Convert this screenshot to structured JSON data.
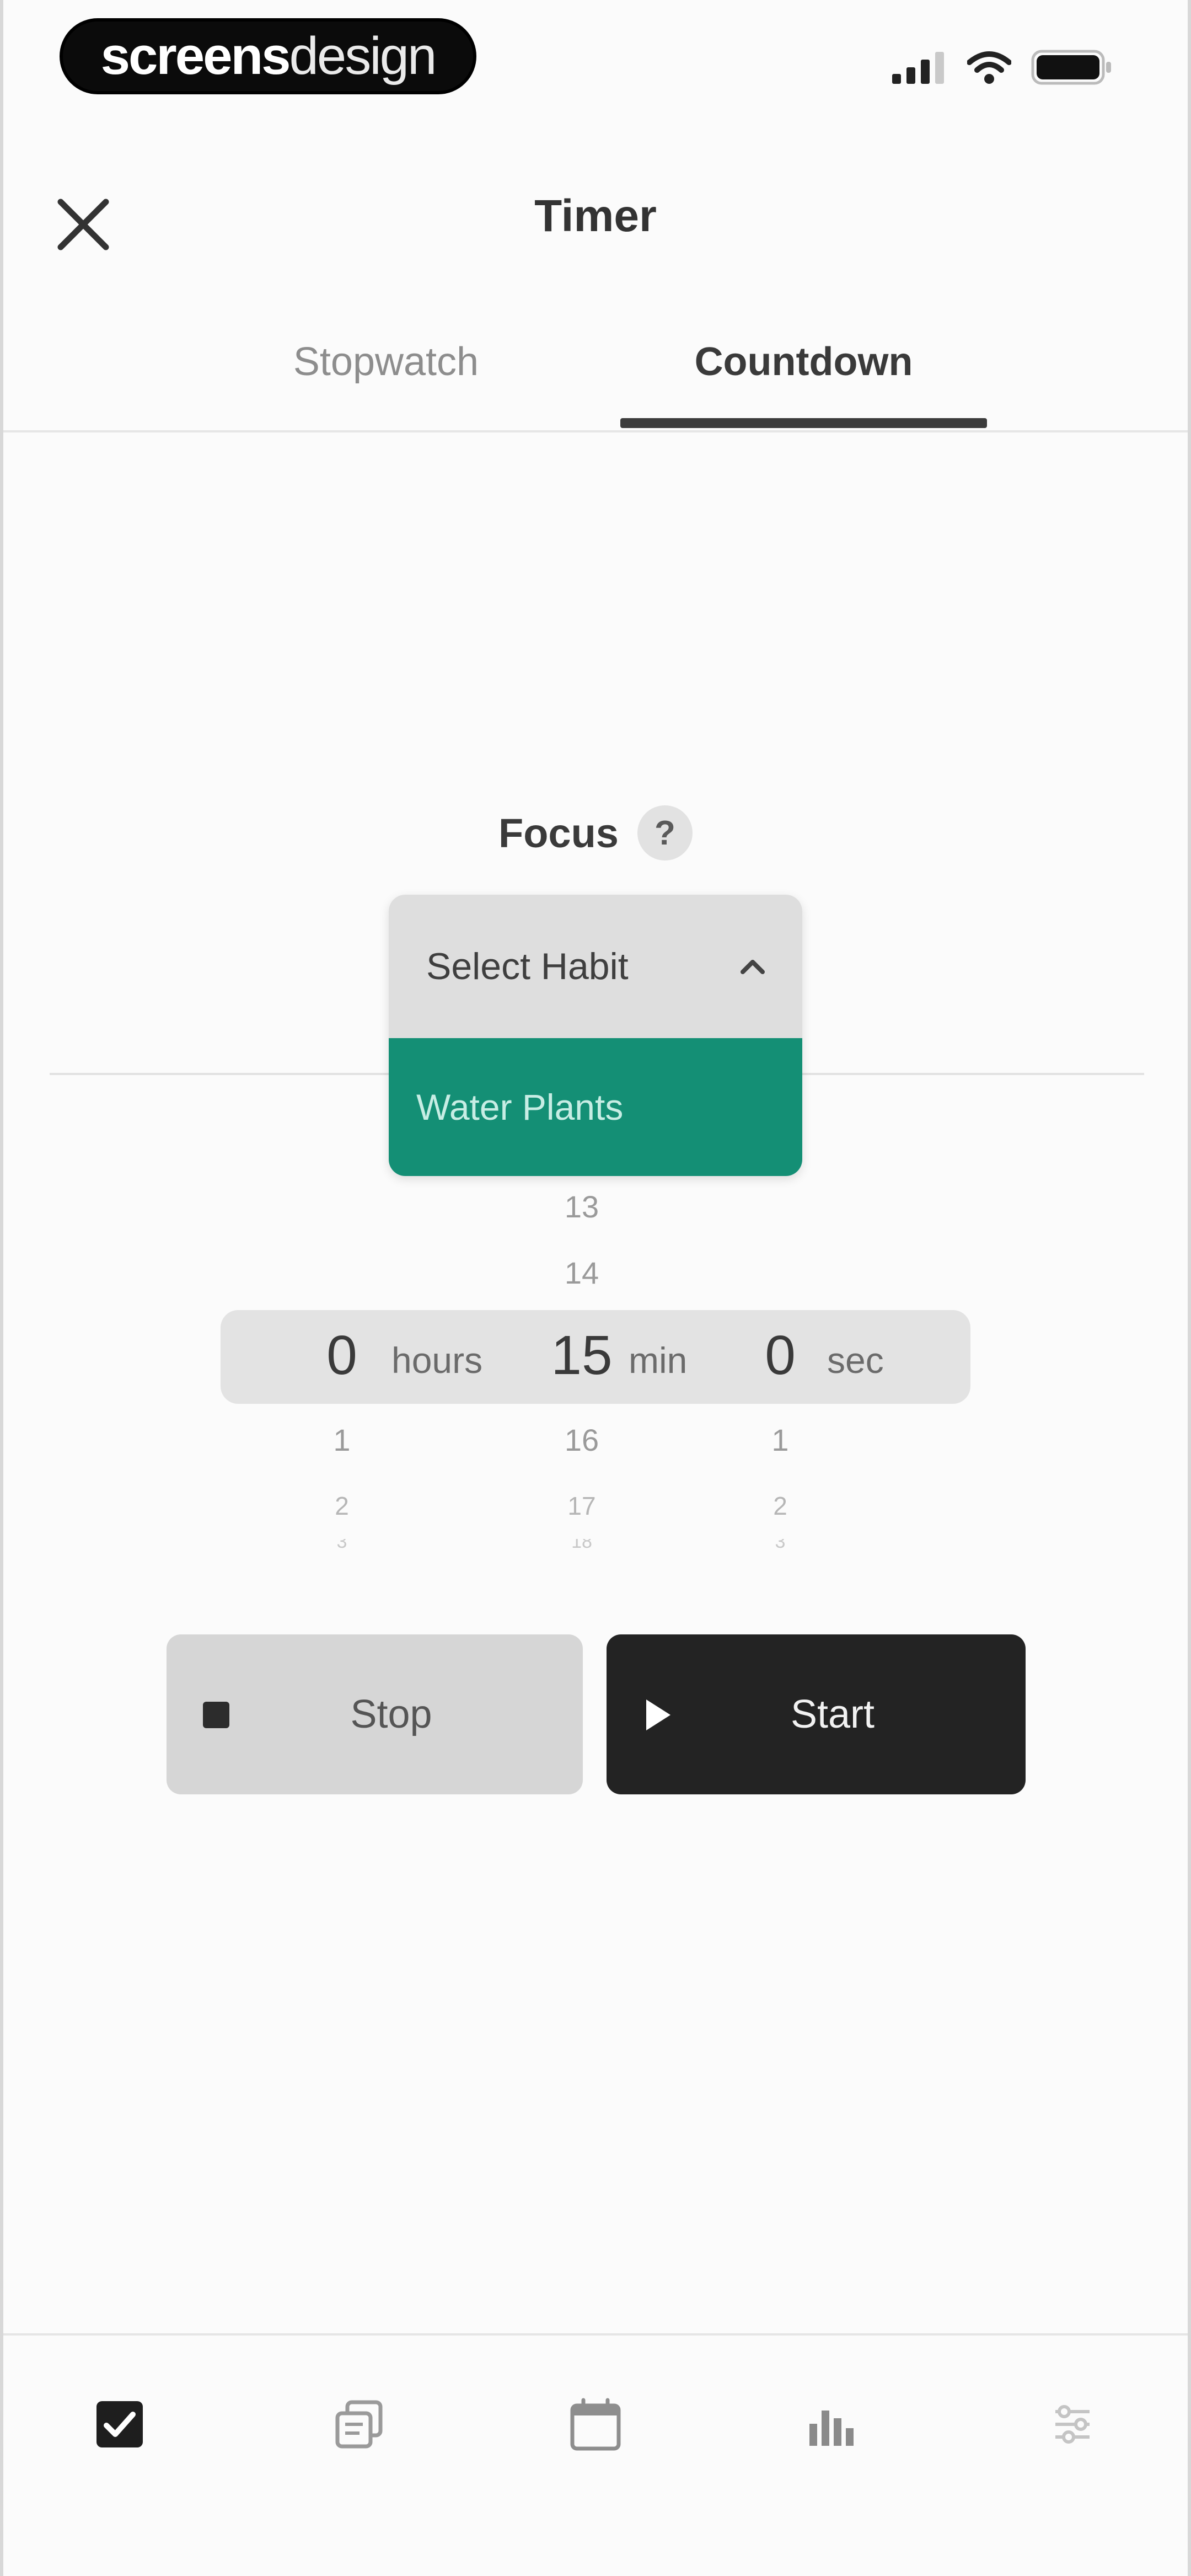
{
  "status_bar": {
    "brand_bold": "screens",
    "brand_light": "design",
    "icons": [
      "cellular-signal-icon",
      "wifi-icon",
      "battery-icon"
    ]
  },
  "header": {
    "title": "Timer",
    "close_icon": "close-icon"
  },
  "tabs": [
    {
      "label": "Stopwatch",
      "active": false
    },
    {
      "label": "Countdown",
      "active": true
    }
  ],
  "focus": {
    "label": "Focus",
    "help_glyph": "?"
  },
  "habit_dropdown": {
    "placeholder": "Select Habit",
    "expanded": true,
    "options": [
      "Water Plants"
    ]
  },
  "time_picker": {
    "hours": {
      "above": [
        "",
        ""
      ],
      "value": "0",
      "below": [
        "1",
        "2",
        "3"
      ],
      "unit": "hours"
    },
    "minutes": {
      "above": [
        "13",
        "14"
      ],
      "value": "15",
      "below": [
        "16",
        "17",
        "18"
      ],
      "unit": "min"
    },
    "seconds": {
      "above": [
        "",
        ""
      ],
      "value": "0",
      "below": [
        "1",
        "2",
        "3"
      ],
      "unit": "sec"
    }
  },
  "buttons": {
    "stop": "Stop",
    "start": "Start"
  },
  "bottom_nav": [
    {
      "icon": "checkbox-icon",
      "active": true
    },
    {
      "icon": "stack-icon",
      "active": false
    },
    {
      "icon": "calendar-icon",
      "active": false
    },
    {
      "icon": "stats-icon",
      "active": false
    },
    {
      "icon": "settings-icon",
      "active": false
    }
  ],
  "colors": {
    "accent_green": "#148f75",
    "dark_button": "#232323",
    "light_button": "#d6d6d6"
  }
}
